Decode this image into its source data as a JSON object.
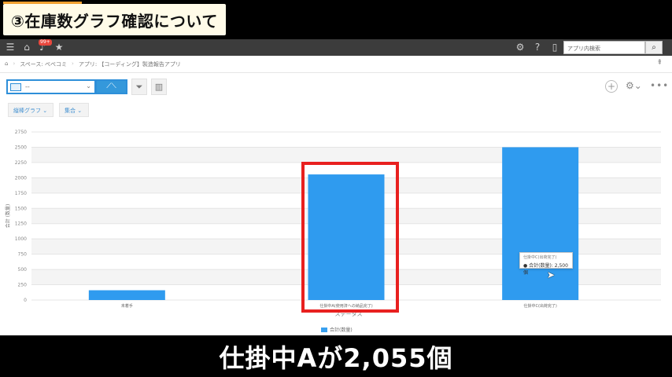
{
  "video_title": "③在庫数グラフ確認について",
  "caption": "仕掛中Aが2,055個",
  "header": {
    "notification_count": "99+",
    "search_placeholder": "アプリ内検索",
    "icons": [
      "menu-icon",
      "home-icon",
      "bell-icon",
      "star-icon",
      "gear-icon",
      "help-icon",
      "mobile-icon",
      "search-icon"
    ]
  },
  "breadcrumb": {
    "items": [
      "スペース: ぺぺコミ",
      "アプリ: 【コーディング】製造報告アプリ"
    ]
  },
  "toolbar": {
    "view_value": "--",
    "chart_type_symbol": "⟋⟍",
    "add_symbol": "+",
    "more_symbol": "•••"
  },
  "pills": {
    "chart_kind": "縦棒グラフ",
    "aggregate": "集合"
  },
  "chart_data": {
    "type": "bar",
    "categories": [
      "未着手",
      "仕掛中A(使用済への納品完了)",
      "仕掛中C(出荷完了)"
    ],
    "series": [
      {
        "name": "合計(数量)",
        "values": [
          160,
          2055,
          2500
        ]
      }
    ],
    "ylabel": "合計 (数量)",
    "xlabel": "ステータス",
    "ylim": [
      0,
      2750
    ],
    "yticks": [
      0,
      250,
      500,
      750,
      1000,
      1250,
      1500,
      1750,
      2000,
      2250,
      2500,
      2750
    ],
    "grid": true,
    "legend": "bottom",
    "colors": {
      "bar": "#2f9bef",
      "highlight": "#e8201f"
    }
  },
  "tooltip": {
    "title": "仕掛中C(出荷完了)",
    "value": "● 合計(数量): 2,500個"
  }
}
